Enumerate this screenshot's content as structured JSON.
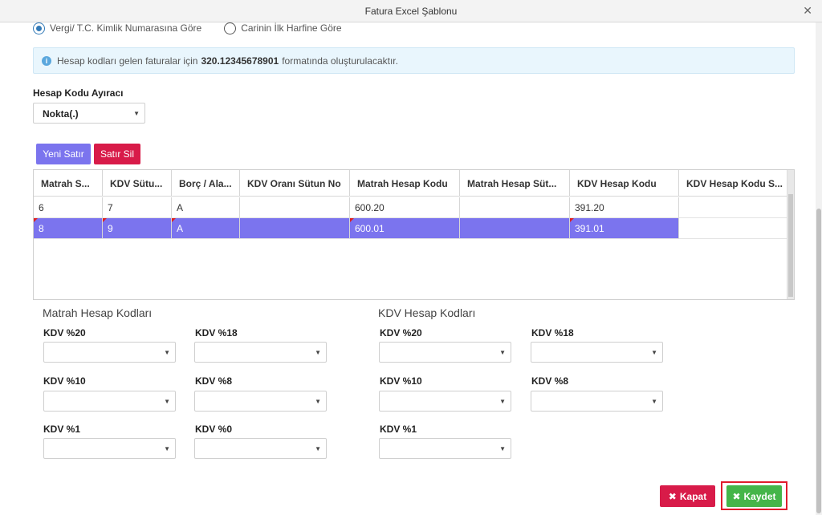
{
  "window": {
    "title": "Fatura Excel Şablonu",
    "close_glyph": "✕"
  },
  "radios": [
    {
      "label": "Vergi/ T.C. Kimlik Numarasına Göre",
      "checked": true
    },
    {
      "label": "Carinin İlk Harfine Göre",
      "checked": false
    }
  ],
  "info": {
    "icon": "info-icon",
    "text_before": "Hesap kodları gelen faturalar için",
    "code_example": "320.12345678901",
    "text_after": "formatında oluşturulacaktır."
  },
  "separator": {
    "label": "Hesap Kodu Ayıracı",
    "value": "Nokta(.)"
  },
  "toolbar": {
    "new_row": "Yeni Satır",
    "delete_row": "Satır Sil"
  },
  "grid": {
    "columns": [
      "Matrah S...",
      "KDV Sütu...",
      "Borç / Ala...",
      "KDV Oranı Sütun No",
      "Matrah Hesap Kodu",
      "Matrah Hesap Süt...",
      "KDV Hesap Kodu",
      "KDV Hesap Kodu S..."
    ],
    "rows": [
      [
        "6",
        "7",
        "A",
        "",
        "600.20",
        "",
        "391.20",
        ""
      ],
      [
        "8",
        "9",
        "A",
        "",
        "600.01",
        "",
        "391.01",
        ""
      ]
    ],
    "selected_row": 1
  },
  "matrah": {
    "title": "Matrah Hesap Kodları",
    "labels": [
      "KDV %20",
      "KDV %18",
      "KDV %10",
      "KDV %8",
      "KDV %1",
      "KDV %0"
    ]
  },
  "kdv": {
    "title": "KDV Hesap Kodları",
    "labels": [
      "KDV %20",
      "KDV %18",
      "KDV %10",
      "KDV %8",
      "KDV %1"
    ]
  },
  "footer": {
    "close": "Kapat",
    "save": "Kaydet"
  },
  "colors": {
    "accent": "#7b74ee",
    "danger": "#d81b49",
    "success": "#45b549"
  }
}
